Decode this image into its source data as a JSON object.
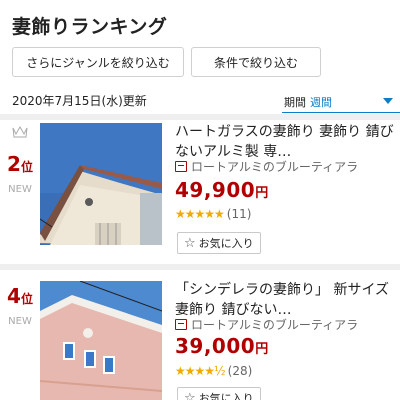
{
  "header": {
    "title": "妻飾りランキング"
  },
  "filters": {
    "genre_label": "さらにジャンルを絞り込む",
    "condition_label": "条件で絞り込む"
  },
  "updated": "2020年7月15日(水)更新",
  "period": {
    "label": "期間",
    "value": "週間"
  },
  "items": [
    {
      "rank": "2",
      "rank_suffix": "位",
      "badge": "NEW",
      "title": "ハートガラスの妻飾り 妻飾り 錆びないアルミ製 専…",
      "shop": "ロートアルミのブルーティアラ",
      "price": "49,900",
      "price_unit": "円",
      "stars": "★★★★★",
      "reviews": "(11)",
      "fav_label": "お気に入り"
    },
    {
      "rank": "4",
      "rank_suffix": "位",
      "badge": "NEW",
      "title": "「シンデレラの妻飾り」 新サイズ 妻飾り 錆びない…",
      "shop": "ロートアルミのブルーティアラ",
      "price": "39,000",
      "price_unit": "円",
      "stars": "★★★★½",
      "reviews": "(28)",
      "fav_label": "お気に入り"
    }
  ],
  "icons": {
    "crown": "crown-icon",
    "shop": "shop-icon",
    "star": "star-outline-icon",
    "caret": "caret-down-icon"
  },
  "colors": {
    "accent": "#b00000",
    "link": "#0a7ec9",
    "star": "#f2a900"
  }
}
